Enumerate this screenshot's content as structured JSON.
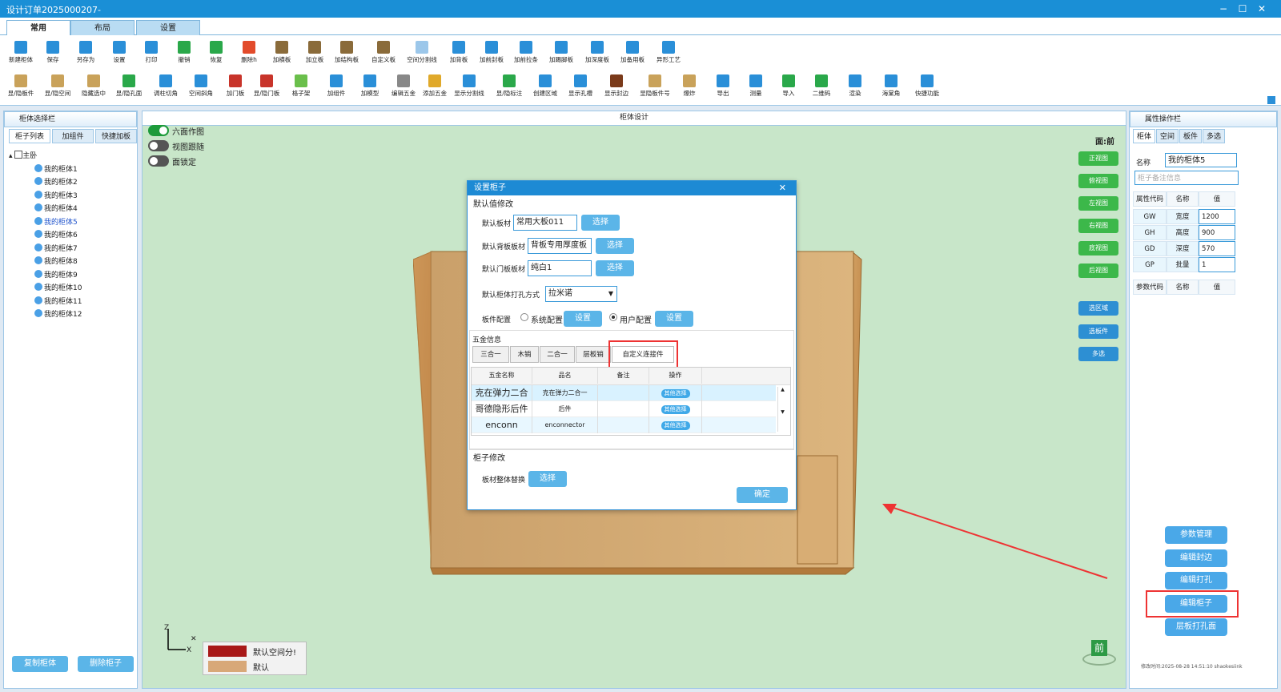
{
  "window": {
    "title": "设计订单2025000207-",
    "min": "−",
    "max": "☐",
    "close": "✕"
  },
  "ribbon_tabs": [
    {
      "label": "常用"
    },
    {
      "label": "布局"
    },
    {
      "label": "设置"
    }
  ],
  "toolbar_row1": [
    {
      "label": "新建柜体",
      "icon": "new-cabinet-icon",
      "color": "#2a8fd8"
    },
    {
      "label": "保存",
      "icon": "save-icon",
      "color": "#2a8fd8"
    },
    {
      "label": "另存为",
      "icon": "save-as-icon",
      "color": "#2a8fd8"
    },
    {
      "label": "设置",
      "icon": "settings-icon",
      "color": "#2a8fd8"
    },
    {
      "label": "打印",
      "icon": "print-icon",
      "color": "#2a8fd8"
    },
    {
      "label": "撤销",
      "icon": "undo-icon",
      "color": "#2aa84a"
    },
    {
      "label": "恢复",
      "icon": "redo-icon",
      "color": "#2aa84a"
    },
    {
      "label": "删除h",
      "icon": "delete-icon",
      "color": "#e24b2b"
    },
    {
      "label": "加横板",
      "icon": "add-horizontal-board-icon",
      "color": "#8a6b3a"
    },
    {
      "label": "加立板",
      "icon": "add-vertical-board-icon",
      "color": "#8a6b3a"
    },
    {
      "label": "加结构板",
      "icon": "add-structure-board-icon",
      "color": "#8a6b3a"
    },
    {
      "label": "自定义板",
      "icon": "custom-board-icon",
      "color": "#8a6b3a"
    },
    {
      "label": "空间分割线",
      "icon": "space-split-icon",
      "color": "#9cc7ea"
    },
    {
      "label": "加背板",
      "icon": "add-back-board-icon",
      "color": "#2a8fd8"
    },
    {
      "label": "加前封板",
      "icon": "add-front-seal-icon",
      "color": "#2a8fd8"
    },
    {
      "label": "加前拉条",
      "icon": "add-front-strip-icon",
      "color": "#2a8fd8"
    },
    {
      "label": "加踢脚板",
      "icon": "add-skirting-icon",
      "color": "#2a8fd8"
    },
    {
      "label": "加深度板",
      "icon": "add-depth-board-icon",
      "color": "#2a8fd8"
    },
    {
      "label": "加备用板",
      "icon": "add-spare-board-icon",
      "color": "#2a8fd8"
    },
    {
      "label": "异形工艺",
      "icon": "irregular-process-icon",
      "color": "#2a8fd8"
    }
  ],
  "toolbar_row2": [
    {
      "label": "显/隐板件",
      "icon": "toggle-board-icon",
      "color": "#c9a25a"
    },
    {
      "label": "显/隐空间",
      "icon": "toggle-space-icon",
      "color": "#c9a25a"
    },
    {
      "label": "隐藏选中",
      "icon": "hide-selected-icon",
      "color": "#c9a25a"
    },
    {
      "label": "显/隐孔面",
      "icon": "toggle-hole-face-icon",
      "color": "#2aa84a"
    },
    {
      "label": "调柱切角",
      "icon": "column-cut-icon",
      "color": "#2a8fd8"
    },
    {
      "label": "空间斜角",
      "icon": "space-bevel-icon",
      "color": "#2a8fd8"
    },
    {
      "label": "加门板",
      "icon": "add-door-icon",
      "color": "#c8342a"
    },
    {
      "label": "显/隐门板",
      "icon": "toggle-door-icon",
      "color": "#c8342a"
    },
    {
      "label": "格子架",
      "icon": "grid-rack-icon",
      "color": "#6abf4b"
    },
    {
      "label": "加组件",
      "icon": "add-component-icon",
      "color": "#2a8fd8"
    },
    {
      "label": "加模型",
      "icon": "add-model-icon",
      "color": "#2a8fd8"
    },
    {
      "label": "编辑五金",
      "icon": "edit-hardware-icon",
      "color": "#888888"
    },
    {
      "label": "添加五金",
      "icon": "add-hardware-icon",
      "color": "#e0a92a"
    },
    {
      "label": "显示分割线",
      "icon": "show-split-line-icon",
      "color": "#2a8fd8"
    },
    {
      "label": "显/隐标注",
      "icon": "toggle-annotation-icon",
      "color": "#2aa84a"
    },
    {
      "label": "创建区域",
      "icon": "create-area-icon",
      "color": "#2a8fd8"
    },
    {
      "label": "显示孔槽",
      "icon": "show-hole-icon",
      "color": "#2a8fd8"
    },
    {
      "label": "显示封边",
      "icon": "show-edge-icon",
      "color": "#7a3a1a"
    },
    {
      "label": "显隐板件号",
      "icon": "toggle-board-number-icon",
      "color": "#c9a25a"
    },
    {
      "label": "爆炸",
      "icon": "explode-icon",
      "color": "#c9a25a"
    },
    {
      "label": "导出",
      "icon": "export-icon",
      "color": "#2a8fd8"
    },
    {
      "label": "测量",
      "icon": "measure-icon",
      "color": "#2a8fd8"
    },
    {
      "label": "导入",
      "icon": "import-icon",
      "color": "#2aa84a"
    },
    {
      "label": "二维码",
      "icon": "qrcode-icon",
      "color": "#2aa84a"
    },
    {
      "label": "渲染",
      "icon": "render-icon",
      "color": "#2a8fd8"
    },
    {
      "label": "海棠角",
      "icon": "begonia-corner-icon",
      "color": "#2a8fd8"
    },
    {
      "label": "快捷功能",
      "icon": "shortcut-icon",
      "color": "#2a8fd8"
    }
  ],
  "left_panel": {
    "title": "柜体选择栏",
    "tabs": [
      {
        "label": "柜子列表"
      },
      {
        "label": "加组件"
      },
      {
        "label": "快捷加板"
      }
    ],
    "root": "主卧",
    "items": [
      {
        "label": "我的柜体1"
      },
      {
        "label": "我的柜体2"
      },
      {
        "label": "我的柜体3"
      },
      {
        "label": "我的柜体4"
      },
      {
        "label": "我的柜体5"
      },
      {
        "label": "我的柜体6"
      },
      {
        "label": "我的柜体7"
      },
      {
        "label": "我的柜体8"
      },
      {
        "label": "我的柜体9"
      },
      {
        "label": "我的柜体10"
      },
      {
        "label": "我的柜体11"
      },
      {
        "label": "我的柜体12"
      }
    ],
    "copy_btn": "复制柜体",
    "delete_btn": "删除柜子"
  },
  "center": {
    "title": "柜体设计",
    "toggles": [
      {
        "label": "六面作图",
        "on": true
      },
      {
        "label": "视图跟随",
        "on": false
      },
      {
        "label": "面锁定",
        "on": false
      }
    ],
    "face_label": "面:前",
    "view_buttons": [
      {
        "label": "正视图"
      },
      {
        "label": "俯视图"
      },
      {
        "label": "左视图"
      },
      {
        "label": "右视图"
      },
      {
        "label": "底视图"
      },
      {
        "label": "后视图"
      }
    ],
    "select_buttons": [
      {
        "label": "选区域"
      },
      {
        "label": "选板件"
      },
      {
        "label": "多选"
      }
    ],
    "legend": [
      {
        "label": "默认空间分!",
        "color": "#a81818"
      },
      {
        "label": "默认",
        "color": "#d8a878"
      }
    ],
    "axis": {
      "z": "Z",
      "x": "X"
    },
    "cube_face": "前"
  },
  "dialog": {
    "title": "设置柜子",
    "close": "✕",
    "section_default": "默认值修改",
    "fields": [
      {
        "label": "默认板材",
        "value": "常用大板011",
        "button": "选择"
      },
      {
        "label": "默认背板板材",
        "value": "背板专用厚度板",
        "button": "选择"
      },
      {
        "label": "默认门板板材",
        "value": "纯白1",
        "button": "选择"
      }
    ],
    "drill_label": "默认柜体打孔方式",
    "drill_value": "拉米诺",
    "board_config_label": "板件配置",
    "radio_system": "系统配置",
    "radio_user": "用户配置",
    "set_btn": "设置",
    "hardware_section": "五金信息",
    "hw_tabs": [
      {
        "label": "三合一"
      },
      {
        "label": "木销"
      },
      {
        "label": "二合一"
      },
      {
        "label": "层板销"
      },
      {
        "label": "自定义连接件"
      }
    ],
    "hw_headers": [
      "五金名称",
      "品名",
      "备注",
      "操作"
    ],
    "hw_rows": [
      {
        "name": "克在弹力二合",
        "product": "克在弹力二合一",
        "note": "",
        "op": "其他选择"
      },
      {
        "name": "哥德隐形后件",
        "product": "后件",
        "note": "",
        "op": "其他选择"
      },
      {
        "name": "enconn",
        "product": "enconnector",
        "note": "",
        "op": "其他选择"
      }
    ],
    "cabinet_section": "柜子修改",
    "replace_label": "板材整体替换",
    "replace_btn": "选择",
    "ok_btn": "确定"
  },
  "right_panel": {
    "title": "属性操作栏",
    "tabs": [
      {
        "label": "柜体"
      },
      {
        "label": "空间"
      },
      {
        "label": "板件"
      },
      {
        "label": "多选"
      }
    ],
    "name_label": "名称",
    "name_value": "我的柜体5",
    "remark_placeholder": "柜子备注信息",
    "table_headers": [
      "属性代码",
      "名称",
      "值"
    ],
    "props": [
      {
        "code": "GW",
        "name": "宽度",
        "value": "1200"
      },
      {
        "code": "GH",
        "name": "高度",
        "value": "900"
      },
      {
        "code": "GD",
        "name": "深度",
        "value": "570"
      },
      {
        "code": "GP",
        "name": "批量",
        "value": "1"
      }
    ],
    "param_headers": [
      "参数代码",
      "名称",
      "值"
    ],
    "buttons": [
      {
        "label": "参数管理"
      },
      {
        "label": "编辑封边"
      },
      {
        "label": "编辑打孔"
      },
      {
        "label": "编辑柜子"
      },
      {
        "label": "层板打孔面"
      }
    ],
    "footer": "修改时间:2025-08-28 14:51:10 shaokesiink"
  }
}
